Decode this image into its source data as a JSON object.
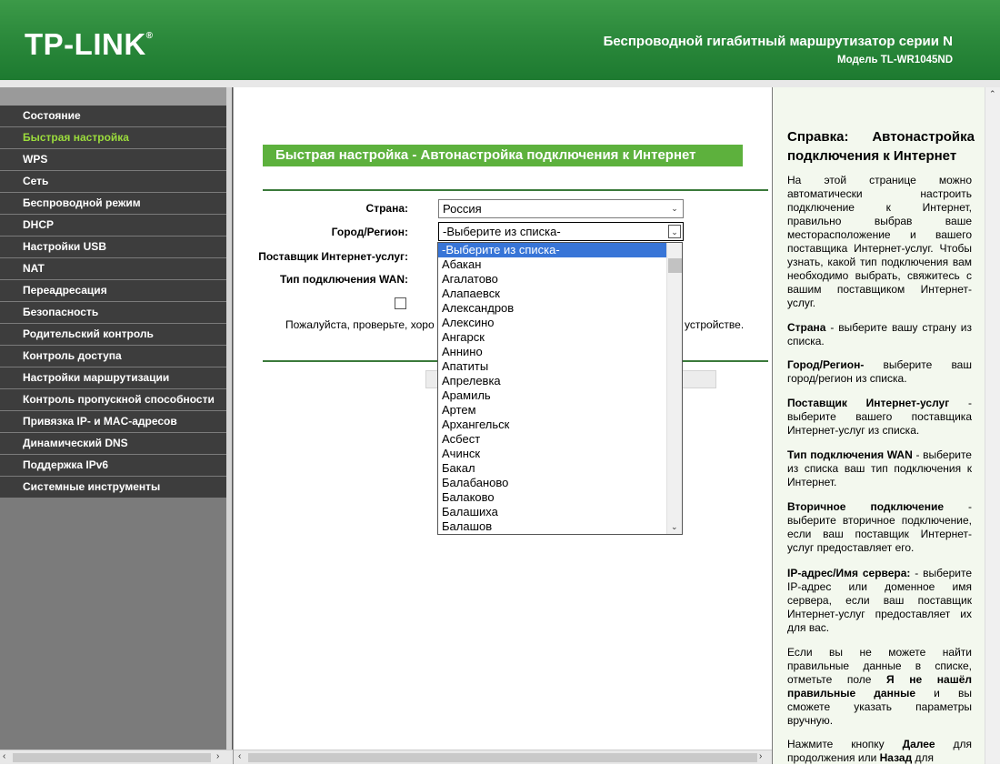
{
  "header": {
    "logo": "TP-LINK",
    "logo_mark": "®",
    "title": "Беспроводной гигабитный маршрутизатор серии N",
    "model": "Модель TL-WR1045ND"
  },
  "menu": {
    "items": [
      {
        "label": "Состояние"
      },
      {
        "label": "Быстрая настройка"
      },
      {
        "label": "WPS"
      },
      {
        "label": "Сеть"
      },
      {
        "label": "Беспроводной режим"
      },
      {
        "label": "DHCP"
      },
      {
        "label": "Настройки USB"
      },
      {
        "label": "NAT"
      },
      {
        "label": "Переадресация"
      },
      {
        "label": "Безопасность"
      },
      {
        "label": "Родительский контроль"
      },
      {
        "label": "Контроль доступа"
      },
      {
        "label": "Настройки маршрутизации"
      },
      {
        "label": "Контроль пропускной способности"
      },
      {
        "label": "Привязка IP- и MAC-адресов"
      },
      {
        "label": "Динамический DNS"
      },
      {
        "label": "Поддержка IPv6"
      },
      {
        "label": "Системные инструменты"
      }
    ],
    "active_index": 1
  },
  "main": {
    "section_title": "Быстрая настройка - Автонастройка подключения к Интернет",
    "country_label": "Страна:",
    "country_value": "Россия",
    "city_label": "Город/Регион:",
    "city_value": "-Выберите из списка-",
    "isp_label": "Поставщик Интернет-услуг:",
    "wan_label": "Тип подключения WAN:",
    "note_left": "Пожалуйста, проверьте, хоро",
    "note_right": "устройстве."
  },
  "dropdown": {
    "options": [
      "-Выберите из списка-",
      "Абакан",
      "Агалатово",
      "Алапаевск",
      "Александров",
      "Алексино",
      "Ангарск",
      "Аннино",
      "Апатиты",
      "Апрелевка",
      "Арамиль",
      "Артем",
      "Архангельск",
      "Асбест",
      "Ачинск",
      "Бакал",
      "Балабаново",
      "Балаково",
      "Балашиха",
      "Балашов"
    ],
    "selected_index": 0
  },
  "help": {
    "title": "Справка: Автонастройка подключения к Интернет",
    "p1": "На этой странице можно автоматически настроить подключение к Интернет, правильно выбрав ваше месторасположение и вашего поставщика Интернет-услуг. Чтобы узнать, какой тип подключения вам необходимо выбрать, свяжитесь с вашим поставщиком Интернет-услуг.",
    "p2_bold": "Страна",
    "p2": " - выберите вашу страну из списка.",
    "p3_bold": "Город/Регион-",
    "p3": " выберите ваш город/регион из списка.",
    "p4_bold": "Поставщик Интернет-услуг",
    "p4": " - выберите вашего поставщика Интернет-услуг из списка.",
    "p5_bold": "Тип подключения WAN",
    "p5": " - выберите из списка ваш тип подключения к Интернет.",
    "p6_bold": "Вторичное подключение",
    "p6": " - выберите вторичное подключение, если ваш поставщик Интернет-услуг предоставляет его.",
    "p7_bold": "IP-адрес/Имя сервера:",
    "p7": " - выберите IP-адрес или доменное имя сервера, если ваш поставщик Интернет-услуг предоставляет их для вас.",
    "p8a": "Если вы не можете найти правильные данные в списке, отметьте поле ",
    "p8_bold": "Я не нашёл правильные данные",
    "p8b": " и вы сможете указать параметры вручную.",
    "p9a": "Нажмите кнопку ",
    "p9_bold1": "Далее",
    "p9b": " для продолжения или ",
    "p9_bold2": "Назад",
    "p9c": " для"
  },
  "colors": {
    "header_green": "#2c8a3c",
    "section_green": "#5db13d",
    "menu_bg": "#3d3d3d",
    "menu_active": "#9bdc3c",
    "selected_option": "#3875d7"
  }
}
